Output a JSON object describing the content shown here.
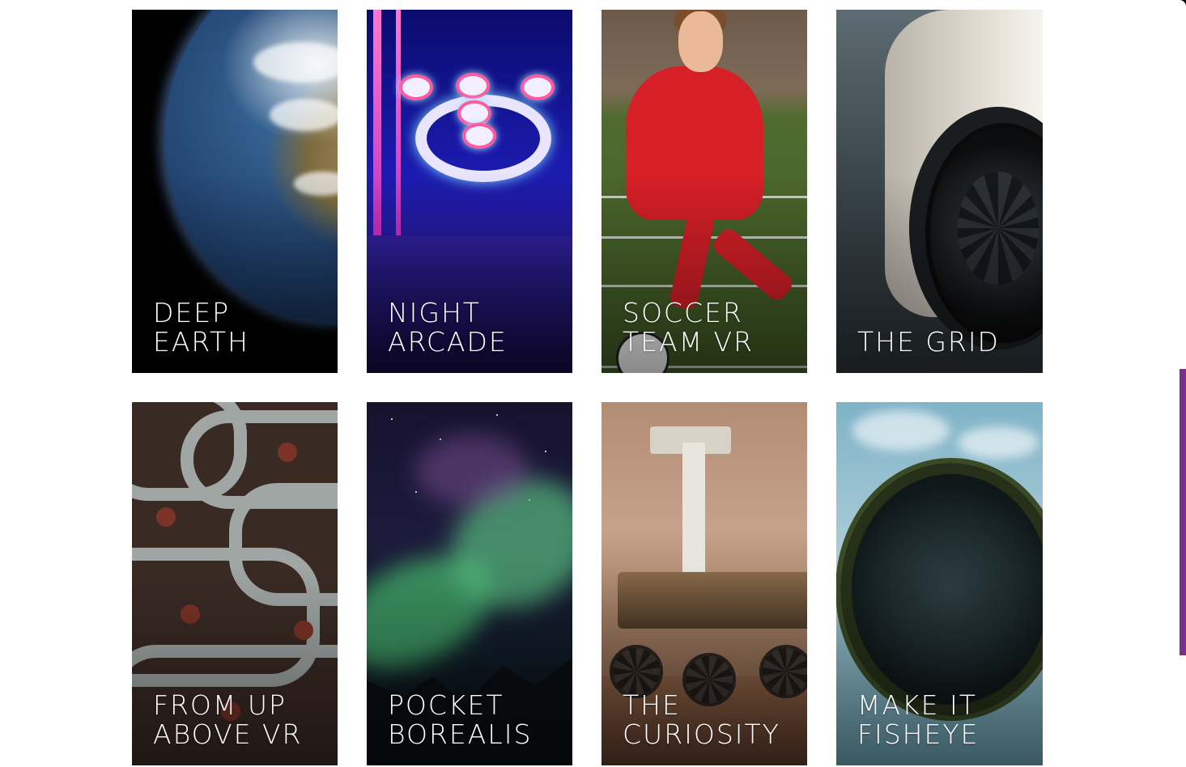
{
  "cards": [
    {
      "title": "DEEP\nEARTH",
      "image": "earth-from-space"
    },
    {
      "title": "NIGHT\nARCADE",
      "image": "skee-ball-arcade"
    },
    {
      "title": "SOCCER\nTEAM VR",
      "image": "soccer-player"
    },
    {
      "title": "THE GRID",
      "image": "race-car-wheel"
    },
    {
      "title": "FROM UP\nABOVE VR",
      "image": "winding-roads-aerial"
    },
    {
      "title": "POCKET\nBOREALIS",
      "image": "aurora-borealis"
    },
    {
      "title": "THE\nCURIOSITY",
      "image": "mars-rover"
    },
    {
      "title": "MAKE IT\nFISHEYE",
      "image": "tiny-planet-fisheye"
    }
  ],
  "colors": {
    "page_background": "#ffffff",
    "scrollbar_thumb": "#7a2e8e",
    "title_text": "#ffffff"
  }
}
